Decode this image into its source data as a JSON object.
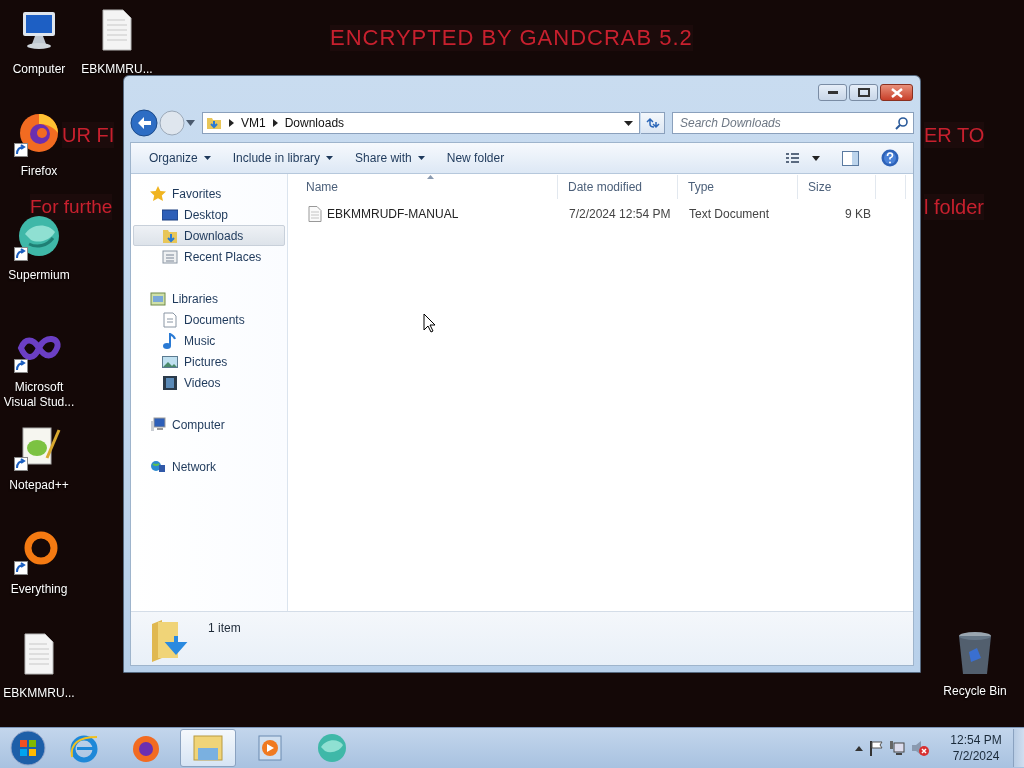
{
  "desktop": {
    "banners": [
      {
        "text": "ENCRYPTED BY GANDCRAB 5.2"
      },
      {
        "text": "UR FI"
      },
      {
        "text": "ER TO"
      },
      {
        "text": "For furthe"
      },
      {
        "text": "l folder"
      }
    ],
    "icons": [
      {
        "label": "Computer",
        "kind": "computer",
        "shortcut": false
      },
      {
        "label": "EBKMMRU...",
        "kind": "document",
        "shortcut": false
      },
      {
        "label": "Firefox",
        "kind": "fox",
        "shortcut": true
      },
      {
        "label": "Supermium",
        "kind": "sphere",
        "shortcut": true
      },
      {
        "label": "Microsoft Visual Stud...",
        "kind": "infinity",
        "shortcut": true
      },
      {
        "label": "Notepad++",
        "kind": "notepad",
        "shortcut": true
      },
      {
        "label": "Everything",
        "kind": "ring",
        "shortcut": true
      },
      {
        "label": "EBKMMRU...",
        "kind": "document",
        "shortcut": false
      },
      {
        "label": "Recycle Bin",
        "kind": "bin",
        "shortcut": false
      }
    ]
  },
  "window": {
    "address": {
      "crumbs": [
        "VM1",
        "Downloads"
      ]
    },
    "search": {
      "placeholder": "Search Downloads"
    },
    "toolbar": [
      {
        "label": "Organize",
        "menu": true
      },
      {
        "label": "Include in library",
        "menu": true
      },
      {
        "label": "Share with",
        "menu": true
      },
      {
        "label": "New folder",
        "menu": false
      }
    ],
    "nav": [
      {
        "label": "Favorites",
        "kind": "star",
        "selected": false,
        "children": [
          {
            "label": "Desktop",
            "kind": "desktop",
            "selected": false
          },
          {
            "label": "Downloads",
            "kind": "downloads",
            "selected": true
          },
          {
            "label": "Recent Places",
            "kind": "recent",
            "selected": false
          }
        ]
      },
      {
        "label": "Libraries",
        "kind": "libraries",
        "selected": false,
        "children": [
          {
            "label": "Documents",
            "kind": "documents",
            "selected": false
          },
          {
            "label": "Music",
            "kind": "music",
            "selected": false
          },
          {
            "label": "Pictures",
            "kind": "pictures",
            "selected": false
          },
          {
            "label": "Videos",
            "kind": "videos",
            "selected": false
          }
        ]
      },
      {
        "label": "Computer",
        "kind": "computer",
        "selected": false
      },
      {
        "label": "Network",
        "kind": "network",
        "selected": false
      }
    ],
    "columns": [
      {
        "label": "Name",
        "sorted": true
      },
      {
        "label": "Date modified",
        "sorted": false
      },
      {
        "label": "Type",
        "sorted": false
      },
      {
        "label": "Size",
        "sorted": false
      }
    ],
    "rows": [
      {
        "cells": [
          "EBKMMRUDF-MANUAL",
          "7/2/2024 12:54 PM",
          "Text Document",
          "9 KB"
        ],
        "selected": false
      }
    ],
    "status": "1 item"
  },
  "taskbar": {
    "apps": [
      {
        "kind": "orb",
        "selected": false
      },
      {
        "kind": "ie",
        "selected": false
      },
      {
        "kind": "fox",
        "selected": false
      },
      {
        "kind": "folder",
        "selected": true
      },
      {
        "kind": "play",
        "selected": false
      },
      {
        "kind": "sphere",
        "selected": false
      }
    ],
    "clock": {
      "time": "12:54 PM",
      "date": "7/2/2024"
    }
  }
}
